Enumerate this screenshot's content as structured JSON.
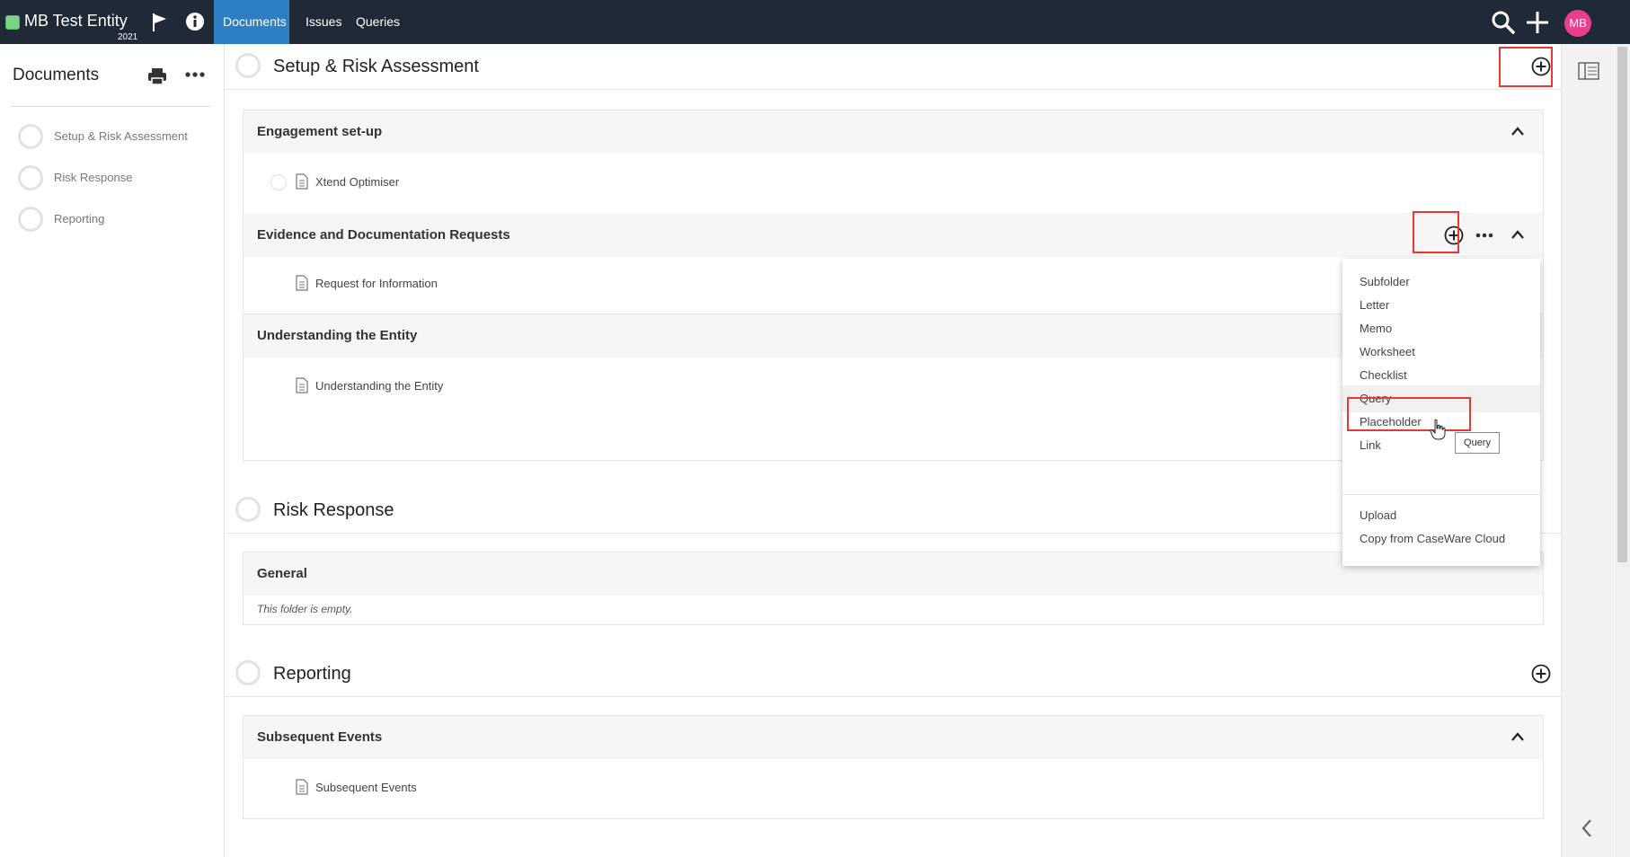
{
  "topbar": {
    "entity_name": "MB Test Entity",
    "year": "2021",
    "tabs": [
      "Documents",
      "Issues",
      "Queries"
    ],
    "active_tab": "Documents",
    "avatar_initials": "MB",
    "icons": [
      "flag-icon",
      "info-icon",
      "search-icon",
      "plus-icon"
    ]
  },
  "sidebar": {
    "title": "Documents",
    "items": [
      {
        "label": "Setup & Risk Assessment"
      },
      {
        "label": "Risk Response"
      },
      {
        "label": "Reporting"
      }
    ]
  },
  "sections": [
    {
      "title": "Setup & Risk Assessment",
      "folders": [
        {
          "title": "Engagement set-up",
          "docs": [
            "Xtend Optimiser"
          ]
        },
        {
          "title": "Evidence and Documentation Requests",
          "docs": [
            "Request for Information"
          ]
        },
        {
          "title": "Understanding the Entity",
          "docs": [
            "Understanding the Entity"
          ]
        }
      ]
    },
    {
      "title": "Risk Response",
      "folders": [
        {
          "title": "General",
          "empty_text": "This folder is empty."
        }
      ]
    },
    {
      "title": "Reporting",
      "folders": [
        {
          "title": "Subsequent Events",
          "docs": [
            "Subsequent Events"
          ]
        }
      ]
    }
  ],
  "add_menu": {
    "items": [
      "Subfolder",
      "Letter",
      "Memo",
      "Worksheet",
      "Checklist",
      "Query",
      "Placeholder",
      "Link"
    ],
    "extra_items": [
      "Upload",
      "Copy from CaseWare Cloud"
    ],
    "highlighted": "Query",
    "tooltip": "Query"
  },
  "colors": {
    "topbar": "#1f2a36",
    "active_tab": "#2e7fc2",
    "avatar": "#e83e8c",
    "highlight_box": "#e53935"
  }
}
